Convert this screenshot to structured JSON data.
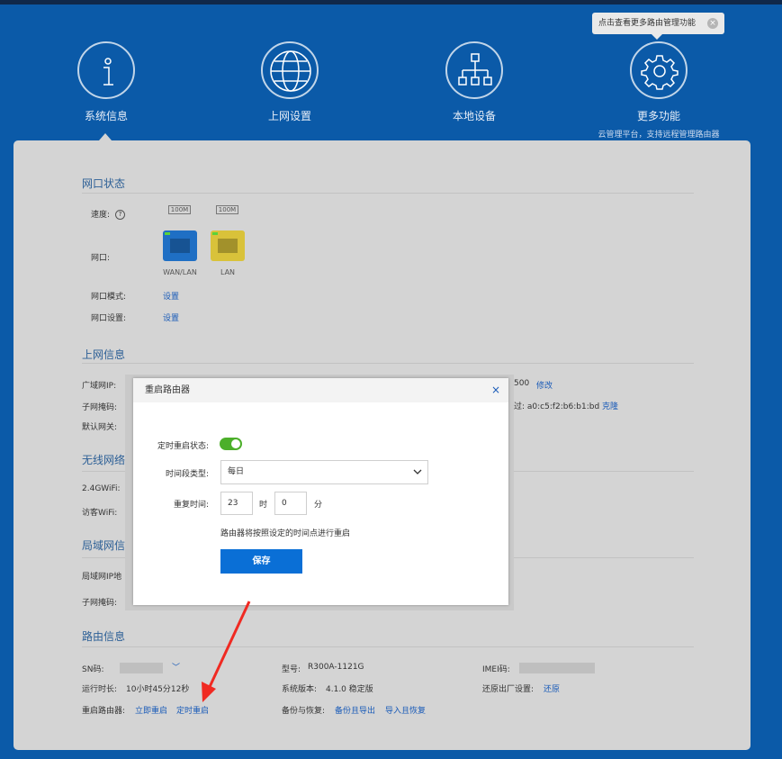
{
  "tooltip": {
    "text": "点击查看更多路由管理功能",
    "close": "×"
  },
  "nav": [
    {
      "label": "系统信息",
      "sub": ""
    },
    {
      "label": "上网设置",
      "sub": ""
    },
    {
      "label": "本地设备",
      "sub": ""
    },
    {
      "label": "更多功能",
      "sub": "云管理平台，支持远程管理路由器"
    }
  ],
  "port_status": {
    "title": "网口状态",
    "speed_label": "速度:",
    "speed_values": [
      "100M",
      "100M"
    ],
    "port_label": "网口:",
    "port_names": [
      "WAN/LAN",
      "LAN"
    ],
    "mode_label": "网口模式:",
    "mode_link": "设置",
    "settings_label": "网口设置:",
    "settings_link": "设置"
  },
  "internet": {
    "title": "上网信息",
    "wan_ip_label": "广域网IP:",
    "mask_label": "子网掩码:",
    "gateway_label": "默认网关:",
    "mtu_tail": "500",
    "mtu_link": "修改",
    "mac_tail": "过: a0:c5:f2:b6:b1:bd",
    "mac_link": "克隆"
  },
  "wireless": {
    "title": "无线网络",
    "wifi24_label": "2.4GWiFi:",
    "guest_label": "访客WiFi:"
  },
  "lan": {
    "title": "局域网信息",
    "ip_label": "局域网IP地",
    "mask_label": "子网掩码:"
  },
  "router": {
    "title": "路由信息",
    "sn_label": "SN码:",
    "model_label": "型号:",
    "model_value": "R300A-1121G",
    "imei_label": "IMEI码:",
    "uptime_label": "运行时长:",
    "uptime_value": "10小时45分12秒",
    "version_label": "系统版本:",
    "version_value": "4.1.0 稳定版",
    "factory_label": "还原出厂设置:",
    "factory_link": "还原",
    "reboot_label": "重启路由器:",
    "reboot_now": "立即重启",
    "reboot_scheduled": "定时重启",
    "backup_label": "备份与恢复:",
    "backup_export": "备份且导出",
    "backup_import": "导入且恢复"
  },
  "modal": {
    "title": "重启路由器",
    "close": "×",
    "status_label": "定时重启状态:",
    "status_on": true,
    "period_label": "时间段类型:",
    "period_value": "每日",
    "repeat_label": "重复时间:",
    "hour_value": "23",
    "hour_unit": "时",
    "minute_value": "0",
    "minute_unit": "分",
    "hint": "路由器将按照设定的时间点进行重启",
    "save_label": "保存"
  },
  "colors": {
    "background": "#0b5aa8",
    "accent": "#0a6fd6",
    "link": "#1a5bb8",
    "toggle_on": "#4caf2a",
    "annotation_arrow": "#f02a22"
  }
}
